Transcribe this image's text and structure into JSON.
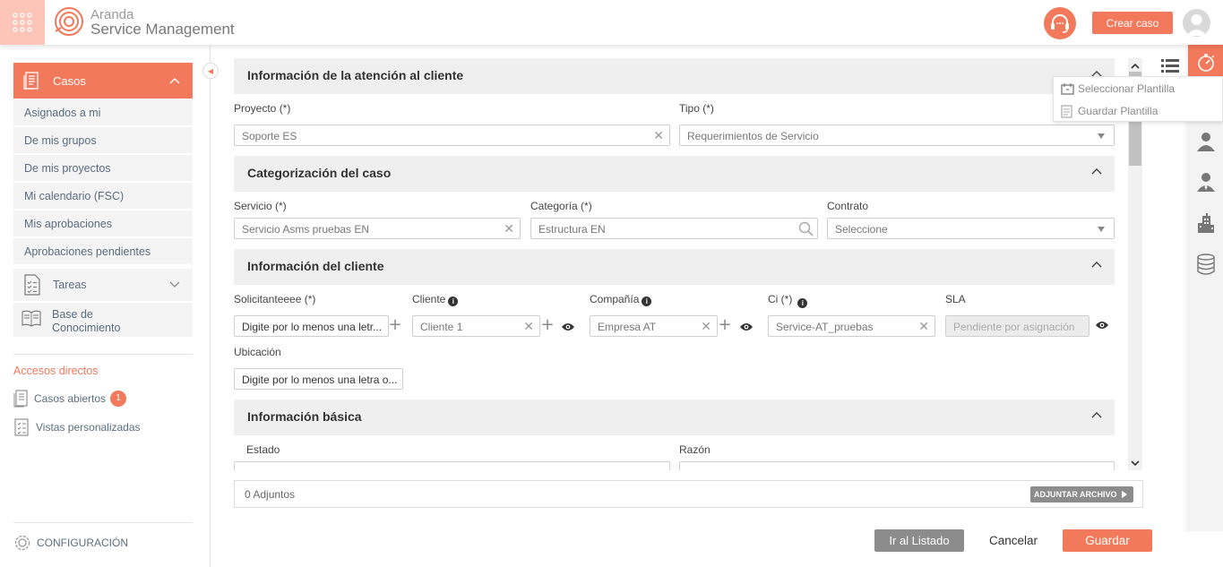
{
  "header": {
    "brand_top": "Aranda",
    "brand_bottom": "Service Management",
    "create_button": "Crear caso"
  },
  "sidebar": {
    "casos_label": "Casos",
    "casos_items": [
      "Asignados a mi",
      "De mis grupos",
      "De mis proyectos",
      "Mi calendario (FSC)",
      "Mis aprobaciones",
      "Aprobaciones pendientes"
    ],
    "tareas_label": "Tareas",
    "base_label_1": "Base de",
    "base_label_2": "Conocimiento",
    "accesos_title": "Accesos directos",
    "casos_abiertos": "Casos abiertos",
    "casos_abiertos_count": "1",
    "vistas": "Vistas personalizadas",
    "config": "CONFIGURACIÓN"
  },
  "sections": {
    "atencion": "Información de la atención al cliente",
    "categorizacion": "Categorización del caso",
    "cliente": "Información del cliente",
    "basica": "Información básica"
  },
  "fields": {
    "proyecto_label": "Proyecto (*)",
    "proyecto_value": "Soporte ES",
    "tipo_label": "Tipo (*)",
    "tipo_value": "Requerimientos de Servicio",
    "servicio_label": "Servicio (*)",
    "servicio_value": "Servicio Asms pruebas EN",
    "categoria_label": "Categoría (*)",
    "categoria_value": "Estructura EN",
    "contrato_label": "Contrato",
    "contrato_value": "Seleccione",
    "solicitante_label": "Solicitanteeee (*)",
    "solicitante_placeholder": "Digite por lo menos una letr...",
    "cliente_label": "Cliente",
    "cliente_value": "Cliente 1",
    "compania_label": "Compañía",
    "compania_value": "Empresa AT",
    "ci_label": "Ci (*)",
    "ci_value": "Service-AT_pruebas",
    "sla_label": "SLA",
    "sla_value": "Pendiente por asignación",
    "ubicacion_label": "Ubicación",
    "ubicacion_placeholder": "Digite por lo menos una letra o...",
    "estado_label": "Estado",
    "razon_label": "Razón"
  },
  "attachments": {
    "label": "0 Adjuntos",
    "button": "ADJUNTAR ARCHIVO"
  },
  "footer": {
    "listado": "Ir al Listado",
    "cancel": "Cancelar",
    "save": "Guardar"
  },
  "template_menu": {
    "select": "Seleccionar Plantilla",
    "save": "Guardar Plantilla"
  },
  "colors": {
    "accent": "#f2795b",
    "accent_light": "#fcc5b7",
    "gray_button": "#8c8c8c"
  }
}
